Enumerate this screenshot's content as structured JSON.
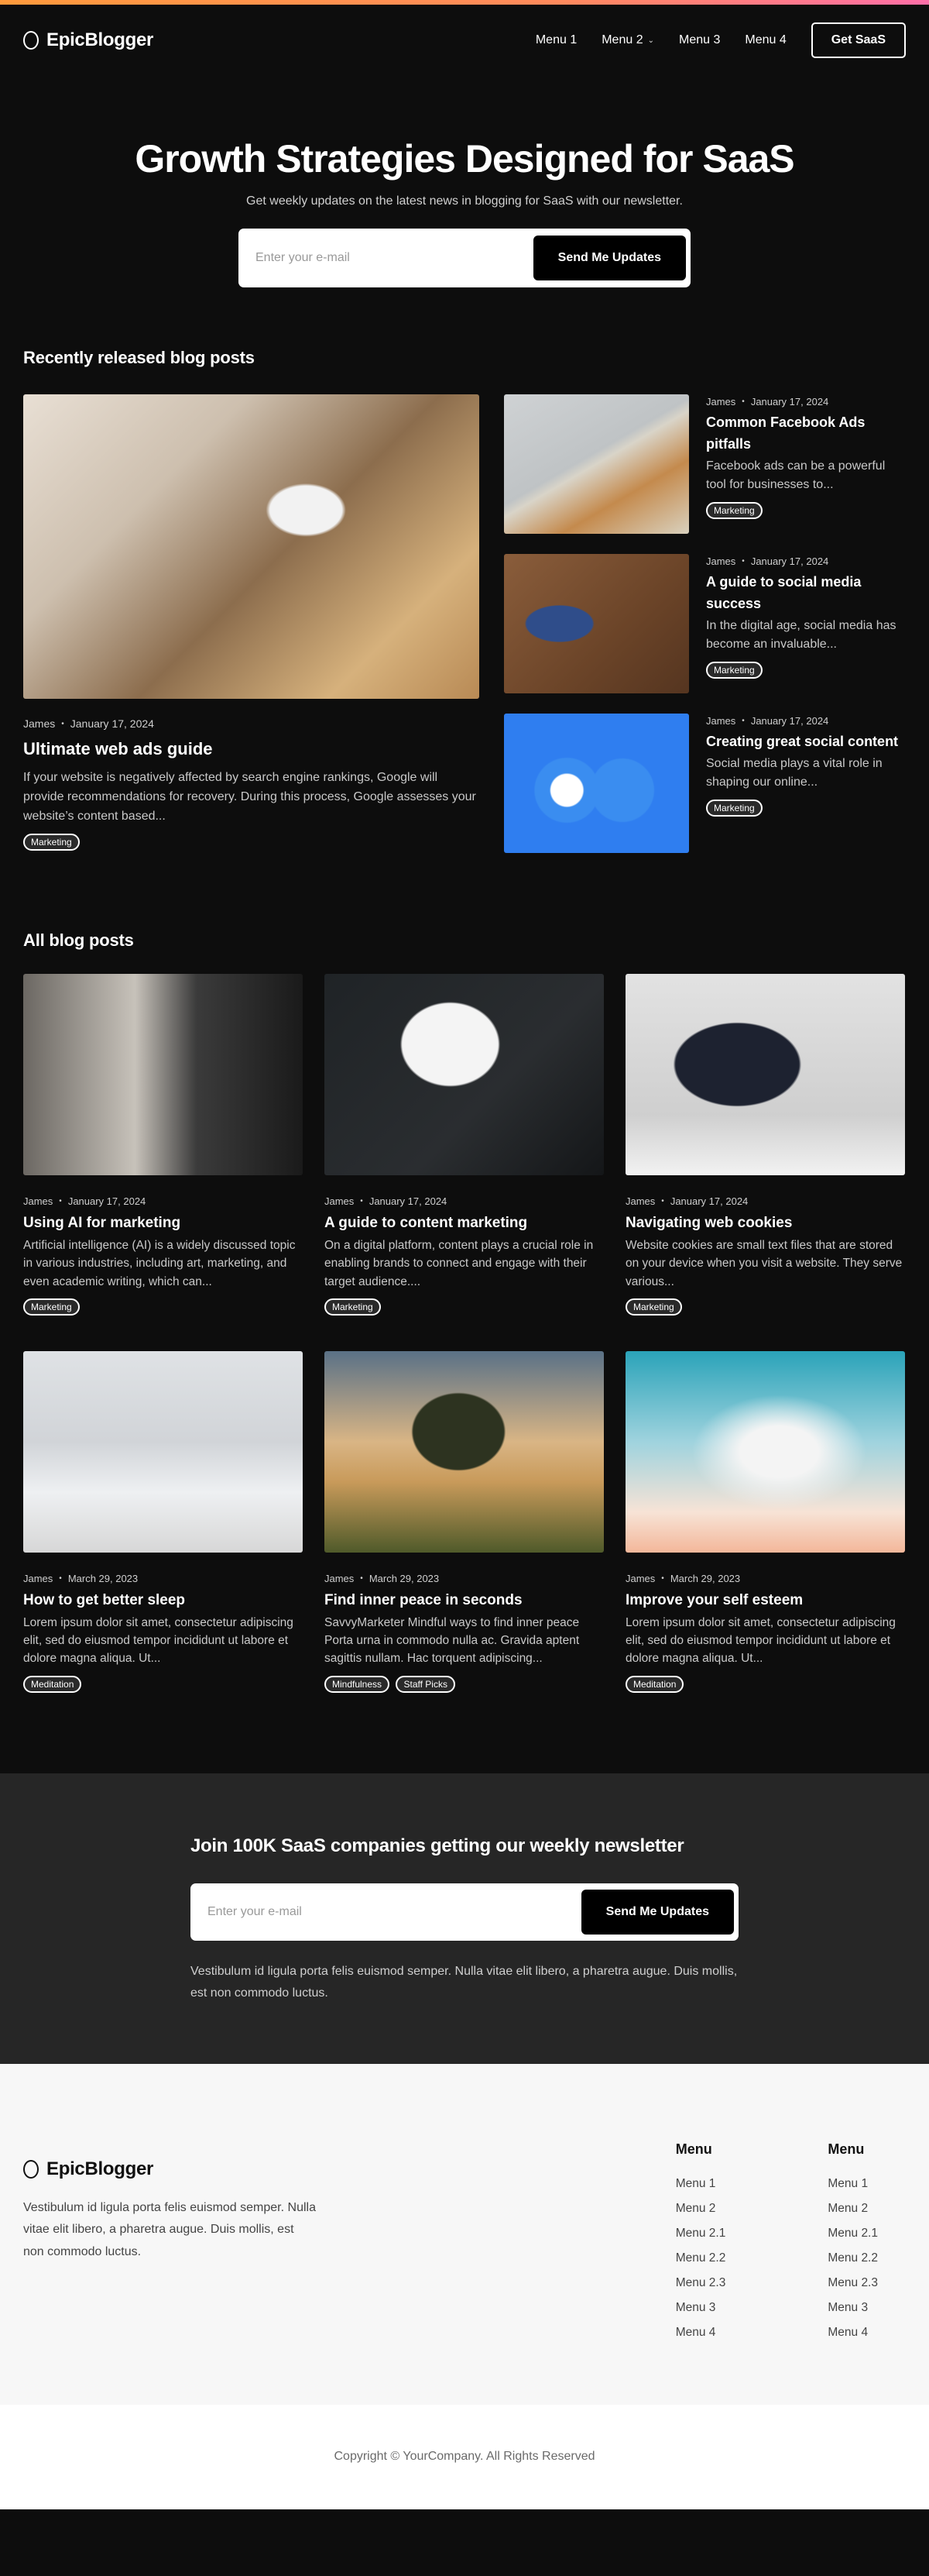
{
  "colors": {
    "accent_gradient_start": "#ff9a3c",
    "accent_gradient_end": "#ff6fa8",
    "page_bg": "#0d0d0d",
    "newsletter_bg": "#262626",
    "footer_bg": "#f7f7f7"
  },
  "header": {
    "logo_icon": "circle-logo-icon",
    "brand": "EpicBlogger",
    "menu": [
      {
        "label": "Menu 1"
      },
      {
        "label": "Menu 2",
        "has_dropdown": true,
        "icon": "chevron-down-icon",
        "icon_glyph": "⌄"
      },
      {
        "label": "Menu 3"
      },
      {
        "label": "Menu 4"
      }
    ],
    "cta_label": "Get SaaS"
  },
  "hero": {
    "title": "Growth Strategies Designed for SaaS",
    "subtitle": "Get weekly updates on the latest news in blogging for SaaS with our newsletter.",
    "email_placeholder": "Enter your e-mail",
    "button_label": "Send Me Updates"
  },
  "recent": {
    "title": "Recently released blog posts",
    "featured": {
      "author": "James",
      "date": "January 17, 2024",
      "title": "Ultimate web ads guide",
      "excerpt": "If your website is negatively affected by search engine rankings, Google will provide recommendations for recovery. During this process, Google assesses your website’s content based...",
      "tags": [
        "Marketing"
      ],
      "image": "laptop-google-search-photo"
    },
    "side": [
      {
        "author": "James",
        "date": "January 17, 2024",
        "title": "Common Facebook Ads pitfalls",
        "excerpt": "Facebook ads can be a powerful tool for businesses to...",
        "tags": [
          "Marketing"
        ],
        "image": "phone-facebook-laptop-photo"
      },
      {
        "author": "James",
        "date": "January 17, 2024",
        "title": "A guide to social media success",
        "excerpt": "In the digital age, social media has become an invaluable...",
        "tags": [
          "Marketing"
        ],
        "image": "social-media-scrabble-photo"
      },
      {
        "author": "James",
        "date": "January 17, 2024",
        "title": "Creating great social content",
        "excerpt": "Social media plays a vital role in shaping our online...",
        "tags": [
          "Marketing"
        ],
        "image": "messenger-facebook-3d-icons-photo"
      }
    ]
  },
  "all_posts": {
    "title": "All blog posts",
    "posts": [
      {
        "author": "James",
        "date": "January 17, 2024",
        "title": "Using AI for marketing",
        "excerpt": "Artificial intelligence (AI) is a widely discussed topic in various industries, including art, marketing, and even academic writing, which can...",
        "tags": [
          "Marketing"
        ],
        "image": "laptop-code-desk-photo"
      },
      {
        "author": "James",
        "date": "January 17, 2024",
        "title": "A guide to content marketing",
        "excerpt": "On a digital platform, content plays a crucial role in enabling brands to connect and engage with their target audience....",
        "tags": [
          "Marketing"
        ],
        "image": "laptop-analytics-mug-photo"
      },
      {
        "author": "James",
        "date": "January 17, 2024",
        "title": "Navigating web cookies",
        "excerpt": "Website cookies are small text files that are stored on your device when you visit a website. They serve various...",
        "tags": [
          "Marketing"
        ],
        "image": "laptop-code-plant-photo"
      },
      {
        "author": "James",
        "date": "March 29, 2023",
        "title": "How to get better sleep",
        "excerpt": "Lorem ipsum dolor sit amet, consectetur adipiscing elit, sed do eiusmod tempor incididunt ut labore et dolore magna aliqua. Ut...",
        "tags": [
          "Meditation"
        ],
        "image": "bedroom-lamp-photo"
      },
      {
        "author": "James",
        "date": "March 29, 2023",
        "title": "Find inner peace in seconds",
        "excerpt": "SavvyMarketer Mindful ways to find inner peace Porta urna in commodo nulla ac. Gravida aptent sagittis nullam. Hac torquent adipiscing...",
        "tags": [
          "Mindfulness",
          "Staff Picks"
        ],
        "image": "tree-misty-field-photo"
      },
      {
        "author": "James",
        "date": "March 29, 2023",
        "title": "Improve your self esteem",
        "excerpt": "Lorem ipsum dolor sit amet, consectetur adipiscing elit, sed do eiusmod tempor incididunt ut labore et dolore magna aliqua. Ut...",
        "tags": [
          "Meditation"
        ],
        "image": "person-sky-clouds-photo"
      }
    ]
  },
  "newsletter": {
    "title": "Join 100K SaaS companies getting our weekly newsletter",
    "email_placeholder": "Enter your e-mail",
    "button_label": "Send Me Updates",
    "note": "Vestibulum id ligula porta felis euismod semper. Nulla vitae elit libero, a pharetra augue. Duis mollis, est non commodo luctus."
  },
  "footer": {
    "brand": "EpicBlogger",
    "description": "Vestibulum id ligula porta felis euismod semper. Nulla vitae elit libero, a pharetra augue. Duis mollis, est non commodo luctus.",
    "columns": [
      {
        "title": "Menu",
        "items": [
          "Menu 1",
          "Menu 2",
          "Menu 2.1",
          "Menu 2.2",
          "Menu 2.3",
          "Menu 3",
          "Menu 4"
        ]
      },
      {
        "title": "Menu",
        "items": [
          "Menu 1",
          "Menu 2",
          "Menu 2.1",
          "Menu 2.2",
          "Menu 2.3",
          "Menu 3",
          "Menu 4"
        ]
      }
    ],
    "copyright": "Copyright © YourCompany. All Rights Reserved"
  },
  "meta_separator": "•"
}
